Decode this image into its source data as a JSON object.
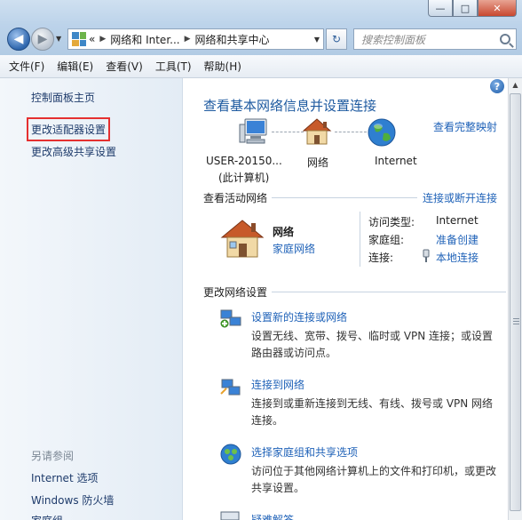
{
  "window": {
    "buttons": {
      "minimize": "—",
      "maximize": "□",
      "close": "✕"
    }
  },
  "nav": {
    "back_icon": "back-arrow-icon",
    "forward_icon": "forward-arrow-icon",
    "breadcrumb": [
      "«",
      "网络和 Inter...",
      "网络和共享中心"
    ],
    "search_placeholder": "搜索控制面板"
  },
  "menu": [
    "文件(F)",
    "编辑(E)",
    "查看(V)",
    "工具(T)",
    "帮助(H)"
  ],
  "sidebar": {
    "links": [
      {
        "label": "控制面板主页"
      },
      {
        "label": "更改适配器设置",
        "highlighted": true
      },
      {
        "label": "更改高级共享设置"
      }
    ],
    "see_also_heading": "另请参阅",
    "see_also": [
      "Internet 选项",
      "Windows 防火墙",
      "家庭组"
    ]
  },
  "main": {
    "title": "查看基本网络信息并设置连接",
    "full_map_link": "查看完整映射",
    "map": {
      "computer_label_1": "USER-20150...",
      "computer_label_2": "(此计算机)",
      "network_label": "网络",
      "internet_label": "Internet"
    },
    "active_networks_heading": "查看活动网络",
    "connect_disconnect_link": "连接或断开连接",
    "network": {
      "name": "网络",
      "type_link": "家庭网络",
      "access_type_label": "访问类型:",
      "access_type_value": "Internet",
      "homegroup_label": "家庭组:",
      "homegroup_value": "准备创建",
      "connections_label": "连接:",
      "connections_value": "本地连接"
    },
    "change_settings_heading": "更改网络设置",
    "tasks": [
      {
        "title": "设置新的连接或网络",
        "desc": "设置无线、宽带、拨号、临时或 VPN 连接；或设置路由器或访问点。"
      },
      {
        "title": "连接到网络",
        "desc": "连接到或重新连接到无线、有线、拨号或 VPN 网络连接。"
      },
      {
        "title": "选择家庭组和共享选项",
        "desc": "访问位于其他网络计算机上的文件和打印机，或更改共享设置。"
      },
      {
        "title": "疑难解答"
      }
    ]
  },
  "colors": {
    "link": "#1f62b8",
    "title": "#1e5aa0",
    "highlight_border": "#e53030"
  }
}
